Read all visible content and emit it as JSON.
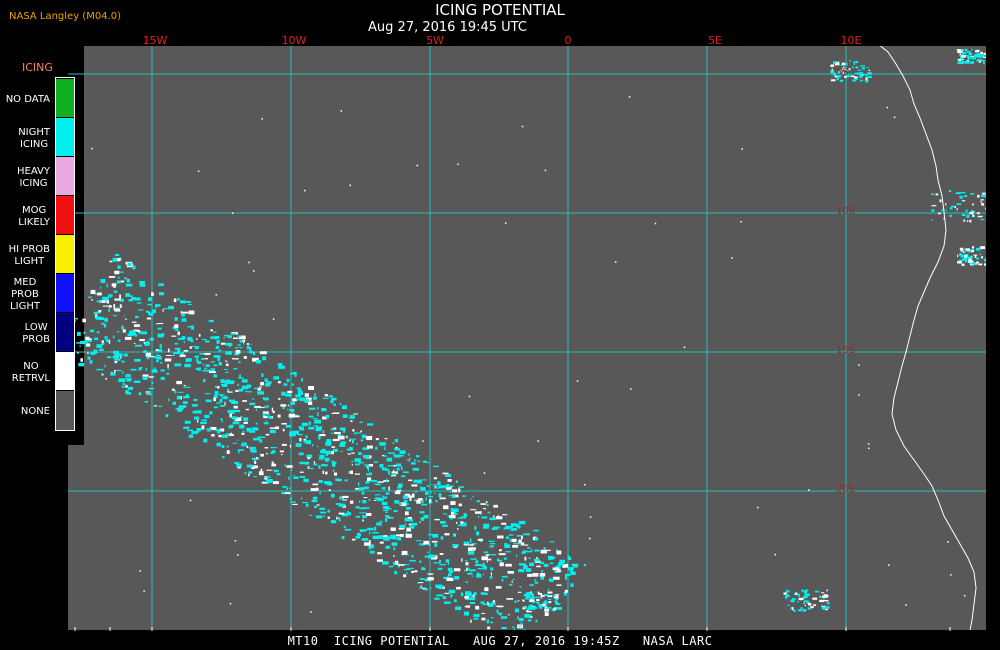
{
  "header": {
    "title": "ICING POTENTIAL",
    "datetime": "Aug 27, 2016 19:45 UTC",
    "organization": "NASA Langley (M04.0)"
  },
  "map": {
    "background_color": "#585858",
    "grid_color": "#20c0c0",
    "coast_color": "#ffffff",
    "longitude_labels": [
      "15W",
      "10W",
      "5W",
      "0",
      "5E",
      "10E"
    ],
    "latitude_labels": [
      "5S",
      "10S",
      "15S",
      "20S"
    ]
  },
  "legend": {
    "title": "ICING",
    "items": [
      {
        "label": "NO DATA",
        "color": "#10b020"
      },
      {
        "label": "NIGHT\nICING",
        "color": "#00f0f0"
      },
      {
        "label": "HEAVY\nICING",
        "color": "#e8a8e0"
      },
      {
        "label": "MOG\nLIKELY",
        "color": "#f01010"
      },
      {
        "label": "HI PROB\nLIGHT",
        "color": "#f8f000"
      },
      {
        "label": "MED PROB\nLIGHT",
        "color": "#1010f8"
      },
      {
        "label": "LOW\nPROB",
        "color": "#000080"
      },
      {
        "label": "NO\nRETRVL",
        "color": "#ffffff"
      },
      {
        "label": "NONE",
        "color": "#585858"
      }
    ]
  },
  "footer": {
    "text": "MT10  ICING POTENTIAL   AUG 27, 2016 19:45Z   NASA LARC"
  }
}
